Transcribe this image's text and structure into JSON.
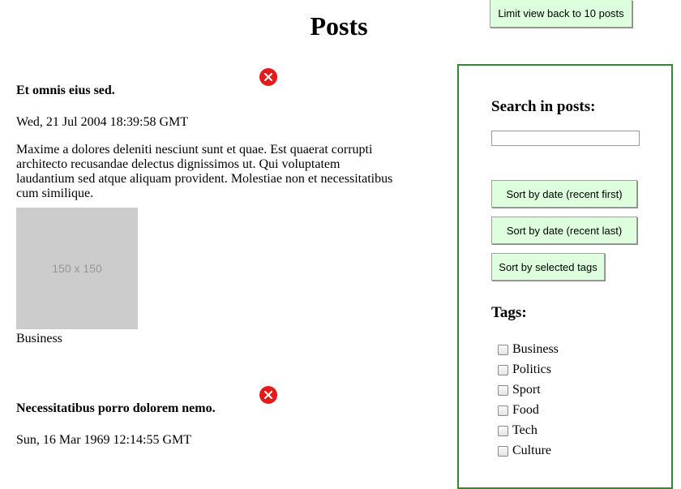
{
  "header": {
    "title": "Posts",
    "limit_button": "Limit view back to 10 posts"
  },
  "posts": [
    {
      "title": "Et omnis eius sed.",
      "date": "Wed, 21 Jul 2004 18:39:58 GMT",
      "body": "Maxime a dolores deleniti nesciunt sunt et quae. Est quaerat corrupti architecto recusandae delectus dignissimos ut. Qui voluptatem laudantium sed atque aliquam provident. Molestiae non et necessitatibus cum similique.",
      "image_label": "150 x 150",
      "tag": "Business",
      "close_icon": "close-icon",
      "close_color": "#e31b1b"
    },
    {
      "title": "Necessitatibus porro dolorem nemo.",
      "date": "Sun, 16 Mar 1969 12:14:55 GMT",
      "close_icon": "close-icon",
      "close_color": "#e31b1b"
    }
  ],
  "sidebar": {
    "search_label": "Search in posts:",
    "search_value": "",
    "sort_buttons": [
      "Sort by date (recent first)",
      "Sort by date (recent last)",
      "Sort by selected tags"
    ],
    "tags_label": "Tags:",
    "tags": [
      "Business",
      "Politics",
      "Sport",
      "Food",
      "Tech",
      "Culture"
    ],
    "border_color": "#2e8b2e",
    "button_color": "#ddffdd"
  }
}
